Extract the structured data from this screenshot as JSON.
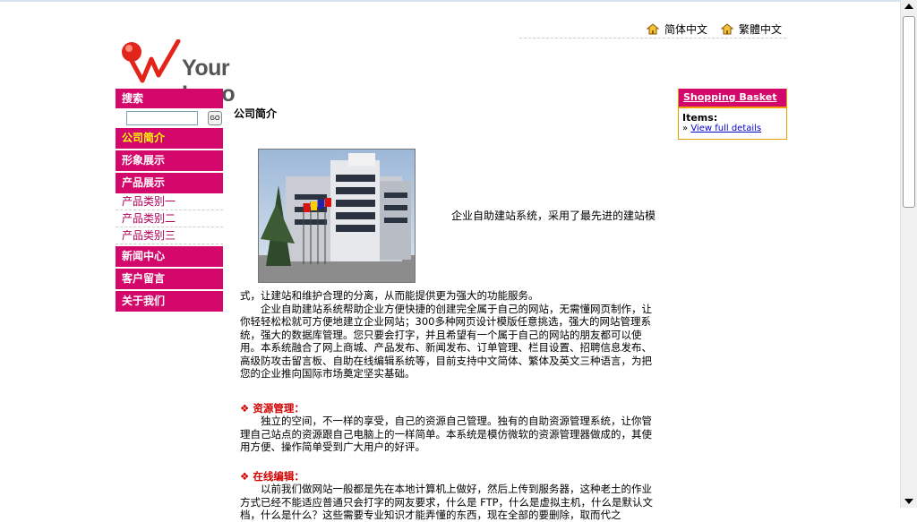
{
  "languages": [
    "简体中文",
    "繁體中文"
  ],
  "logo": {
    "text": "Your Logo"
  },
  "search": {
    "title": "搜索",
    "go_label": "GO",
    "value": ""
  },
  "nav": {
    "items": [
      "公司简介",
      "形象展示",
      "产品展示"
    ],
    "sub_items": [
      "产品类别一",
      "产品类别二",
      "产品类别三"
    ],
    "items2": [
      "新闻中心",
      "客户留言",
      "关于我们"
    ]
  },
  "basket": {
    "title": "Shopping Basket",
    "items_label": "Items:",
    "link_prefix": "»",
    "link": "View full details"
  },
  "main": {
    "title": "公司简介",
    "intro_right": "企业自助建站系统，采用了最先进的建站模",
    "intro_cont": "式，让建站和维护合理的分离，从而能提供更为强大的功能服务。",
    "para1": "　　企业自助建站系统帮助企业方便快捷的创建完全属于自己的网站，无需懂网页制作，让你轻轻松松就可方便地建立企业网站；300多种网页设计模版任意挑选，强大的网站管理系统，强大的数据库管理。您只要会打字，并且希望有一个属于自己的网站的朋友都可以使用。本系统融合了网上商城、产品发布、新闻发布、订单管理、栏目设置、招聘信息发布、高级防攻击留言板、自助在线编辑系统等，目前支持中文简体、繁体及英文三种语言，为把您的企业推向国际市场奠定坚实基础。",
    "section1_title": "资源管理：",
    "section1_text": "　　独立的空间，不一样的享受，自己的资源自己管理。独有的自助资源管理系统，让你管理自己站点的资源跟自己电脑上的一样简单。本系统是模仿微软的资源管理器做成的，其使用方便、操作简单受到广大用户的好评。",
    "section2_title": "在线编辑：",
    "section2_text": "　　以前我们做网站一般都是先在本地计算机上做好，然后上传到服务器，这种老土的作业方式已经不能适应普通只会打字的网友要求，什么是 FTP，什么是虚拟主机，什么是默认文档，什么是什么？这些需要专业知识才能弄懂的东西，现在全部的要删除，取而代之"
  },
  "colors": {
    "brand": "#d4086a",
    "active": "#ffff00",
    "section": "#d00000"
  }
}
